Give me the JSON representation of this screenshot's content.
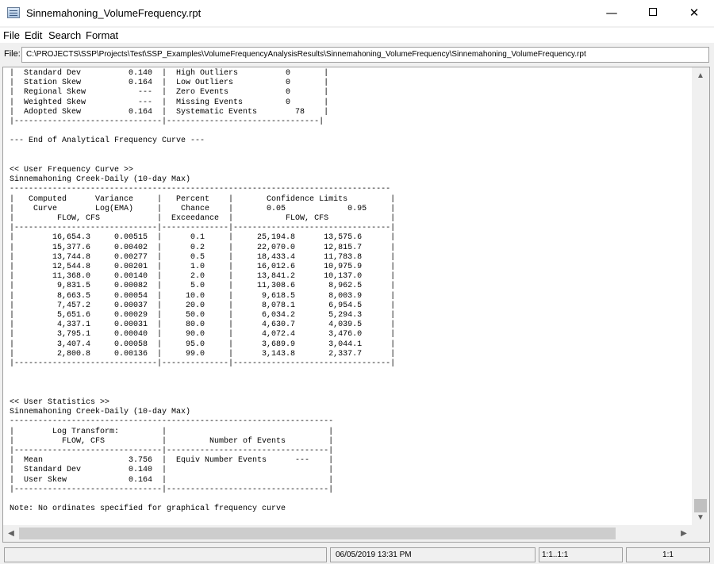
{
  "window": {
    "title": "Sinnemahoning_VolumeFrequency.rpt",
    "minimize_glyph": "—",
    "close_glyph": "✕"
  },
  "menu": {
    "file": "File",
    "edit": "Edit",
    "search": "Search",
    "format": "Format"
  },
  "file_field": {
    "label": "File:",
    "path": "C:\\PROJECTS\\SSP\\Projects\\Test\\SSP_Examples\\VolumeFrequencyAnalysisResults\\Sinnemahoning_VolumeFrequency\\Sinnemahoning_VolumeFrequency.rpt"
  },
  "report_lines": [
    "|  Standard Dev          0.140  |  High Outliers          0       |",
    "|  Station Skew          0.164  |  Low Outliers           0       |",
    "|  Regional Skew           ---  |  Zero Events            0       |",
    "|  Weighted Skew           ---  |  Missing Events         0       |",
    "|  Adopted Skew          0.164  |  Systematic Events        78    |",
    "|-------------------------------|--------------------------------|",
    "",
    "--- End of Analytical Frequency Curve ---",
    "",
    "",
    "<< User Frequency Curve >>",
    "Sinnemahoning Creek-Daily (10-day Max)",
    "--------------------------------------------------------------------------------",
    "|   Computed      Variance     |   Percent    |       Confidence Limits         |",
    "|    Curve        Log(EMA)     |    Chance    |       0.05             0.95     |",
    "|         FLOW, CFS            |  Exceedance  |           FLOW, CFS             |",
    "|------------------------------|--------------|---------------------------------|",
    "|        16,654.3     0.00515  |      0.1     |     25,194.8      13,575.6      |",
    "|        15,377.6     0.00402  |      0.2     |     22,070.0      12,815.7      |",
    "|        13,744.8     0.00277  |      0.5     |     18,433.4      11,783.8      |",
    "|        12,544.8     0.00201  |      1.0     |     16,012.6      10,975.9      |",
    "|        11,368.0     0.00140  |      2.0     |     13,841.2      10,137.0      |",
    "|         9,831.5     0.00082  |      5.0     |     11,308.6       8,962.5      |",
    "|         8,663.5     0.00054  |     10.0     |      9,618.5       8,003.9      |",
    "|         7,457.2     0.00037  |     20.0     |      8,078.1       6,954.5      |",
    "|         5,651.6     0.00029  |     50.0     |      6,034.2       5,294.3      |",
    "|         4,337.1     0.00031  |     80.0     |      4,630.7       4,039.5      |",
    "|         3,795.1     0.00040  |     90.0     |      4,072.4       3,476.0      |",
    "|         3,407.4     0.00058  |     95.0     |      3,689.9       3,044.1      |",
    "|         2,800.8     0.00136  |     99.0     |      3,143.8       2,337.7      |",
    "|------------------------------|--------------|---------------------------------|",
    "",
    "",
    "",
    "<< User Statistics >>",
    "Sinnemahoning Creek-Daily (10-day Max)",
    "--------------------------------------------------------------------",
    "|        Log Transform:         |                                  |",
    "|          FLOW, CFS            |         Number of Events         |",
    "|-------------------------------|----------------------------------|",
    "|  Mean                  3.756  |  Equiv Number Events      ---    |",
    "|  Standard Dev          0.140  |                                  |",
    "|  User Skew             0.164  |                                  |",
    "|-------------------------------|----------------------------------|",
    "",
    "Note: No ordinates specified for graphical frequency curve"
  ],
  "status": {
    "cell1": "",
    "datetime": "06/05/2019 13:31 PM",
    "position": "1:1..1:1",
    "cursor": "1:1"
  }
}
